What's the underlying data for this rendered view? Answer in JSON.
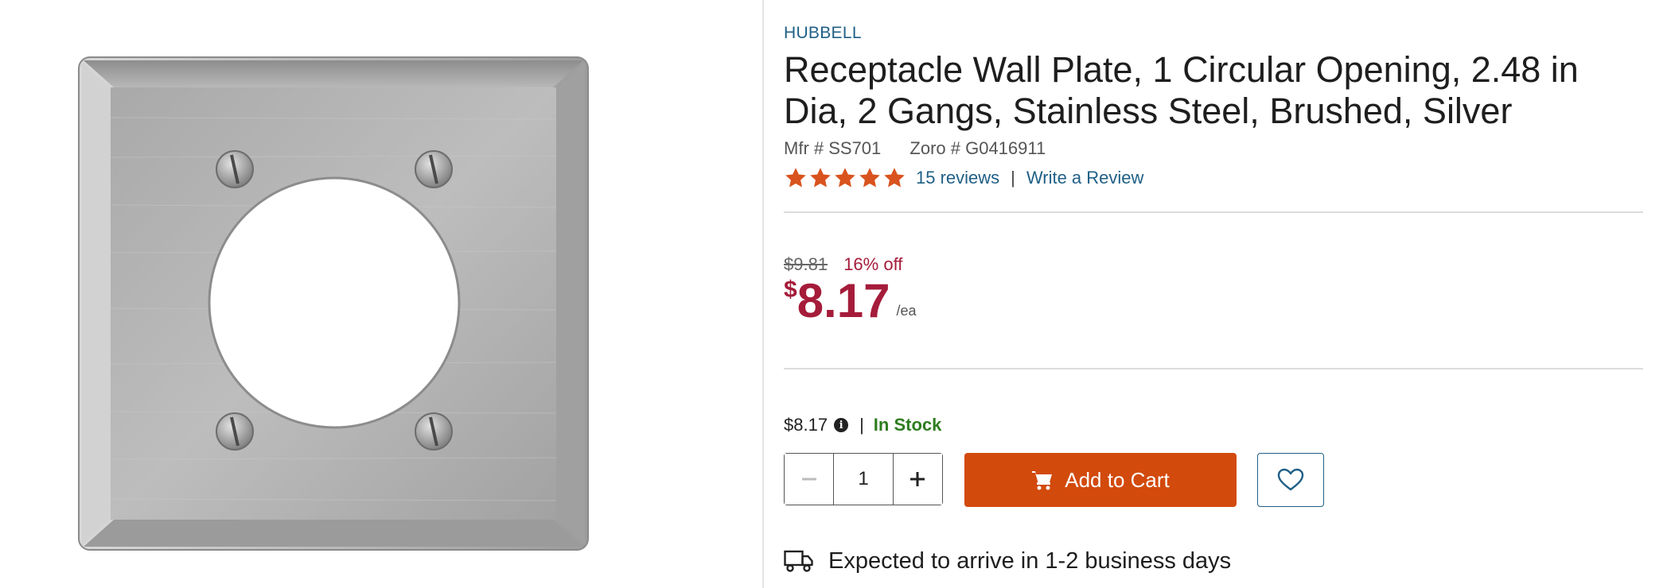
{
  "product": {
    "brand": "HUBBELL",
    "title": "Receptacle Wall Plate, 1 Circular Opening, 2.48 in Dia, 2 Gangs, Stainless Steel, Brushed, Silver",
    "mfr_number": "Mfr # SS701",
    "zoro_number": "Zoro # G0416911",
    "image_alt": "Stainless steel receptacle wall plate with one circular opening"
  },
  "rating": {
    "stars": 5,
    "max_stars": 5,
    "reviews_label": "15 reviews",
    "separator": "|",
    "write_review_label": "Write a Review",
    "star_color": "#d9531e"
  },
  "pricing": {
    "was_price": "$9.81",
    "discount": "16% off",
    "currency_symbol": "$",
    "price": "8.17",
    "unit": "/ea",
    "price_color": "#a51c3a"
  },
  "stock": {
    "price": "$8.17",
    "info_icon": "info-circle-icon",
    "separator": "|",
    "status": "In Stock",
    "status_color": "#2e7d1f"
  },
  "quantity": {
    "value": "1",
    "decrement_icon": "minus-icon",
    "increment_icon": "plus-icon"
  },
  "actions": {
    "add_to_cart_label": "Add to Cart",
    "cart_icon": "shopping-cart-icon",
    "favorite_icon": "heart-icon",
    "button_color": "#d24a0c"
  },
  "delivery": {
    "icon": "truck-icon",
    "text": "Expected to arrive in 1-2 business days"
  }
}
